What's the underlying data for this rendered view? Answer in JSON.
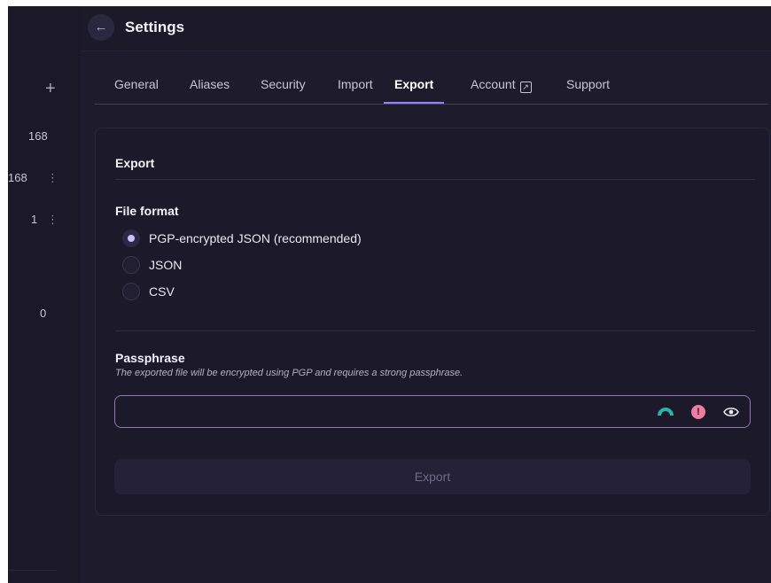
{
  "rail": {
    "counts": [
      "168",
      "168",
      "1",
      "0"
    ]
  },
  "header": {
    "title": "Settings"
  },
  "tabs": [
    {
      "label": "General"
    },
    {
      "label": "Aliases"
    },
    {
      "label": "Security"
    },
    {
      "label": "Import"
    },
    {
      "label": "Export",
      "active": true
    },
    {
      "label": "Account"
    },
    {
      "label": "Support"
    }
  ],
  "export": {
    "heading": "Export",
    "file_format_heading": "File format",
    "formats": [
      {
        "label": "PGP-encrypted JSON (recommended)",
        "selected": true
      },
      {
        "label": "JSON",
        "selected": false
      },
      {
        "label": "CSV",
        "selected": false
      }
    ],
    "passphrase_heading": "Passphrase",
    "passphrase_description": "The exported file will be encrypted using PGP and requires a strong passphrase.",
    "passphrase_value": "",
    "button_label": "Export"
  },
  "colors": {
    "accent": "#8f84ff",
    "warning": "#f07ca0",
    "strength": "#2bb3a8"
  }
}
